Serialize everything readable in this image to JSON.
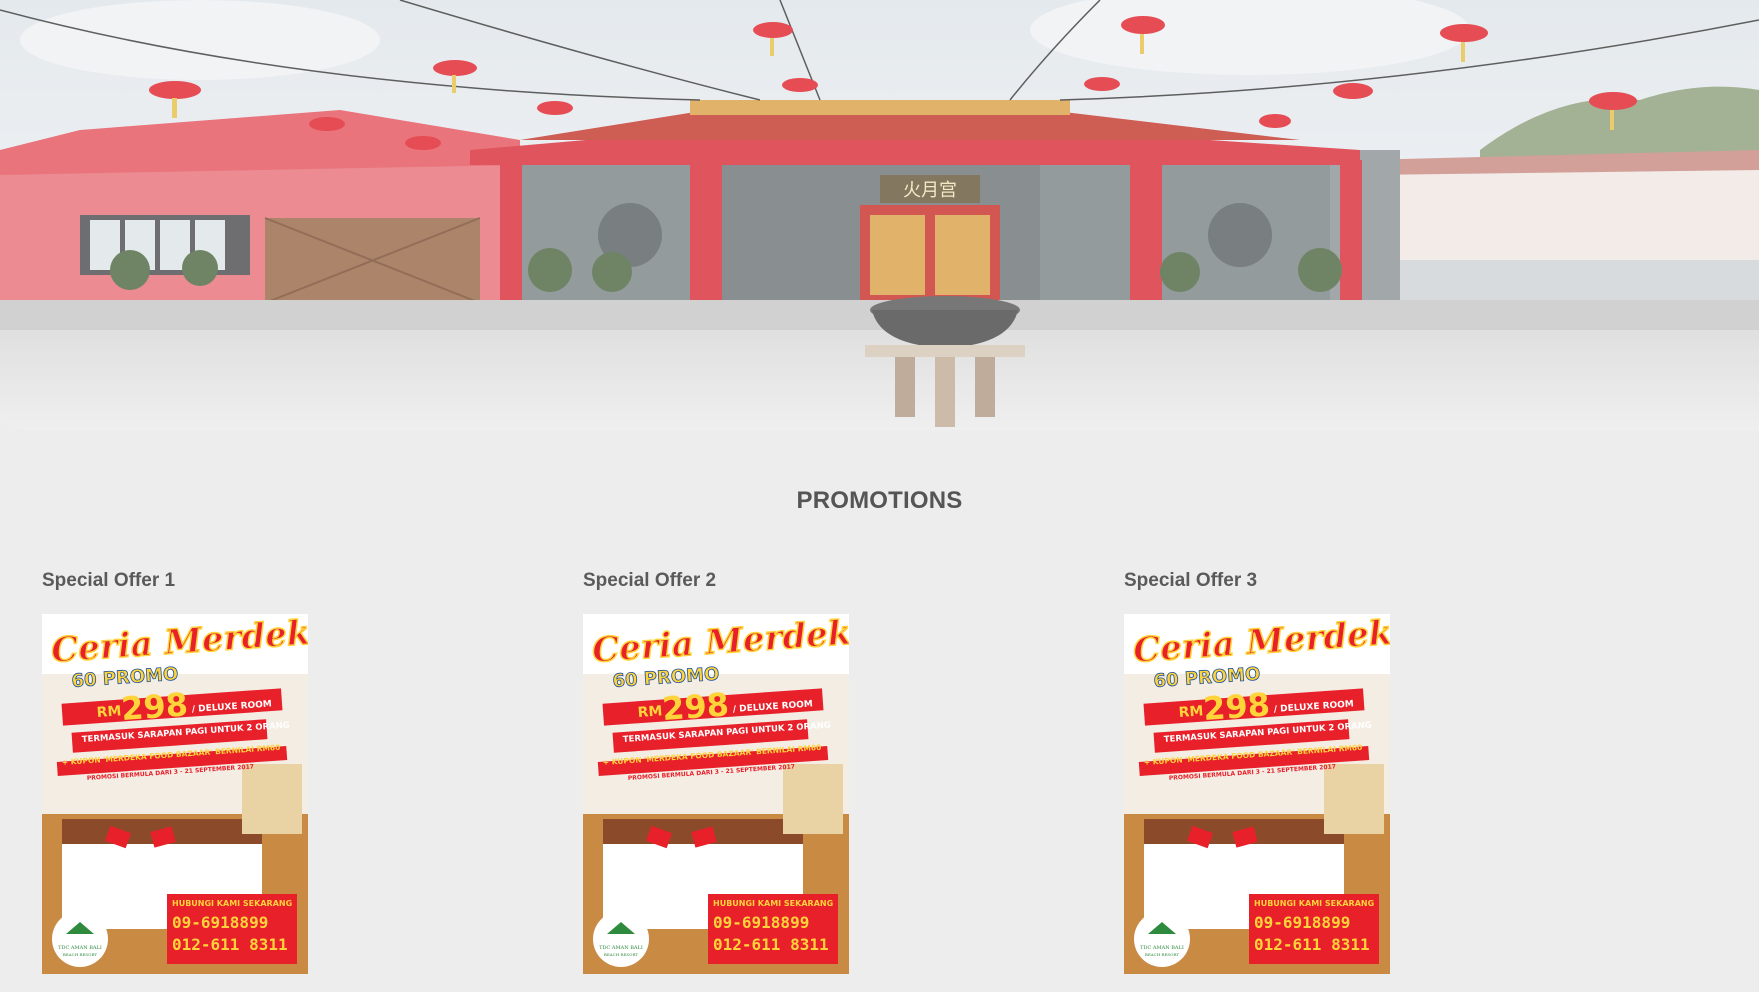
{
  "hero": {
    "image_subject": "Chinese temple with red lanterns",
    "temple_sign": "火月宫"
  },
  "promotions": {
    "title": "PROMOTIONS",
    "offers": [
      {
        "title": "Special Offer 1",
        "poster": {
          "headline": "Ceria Merdeka",
          "subhead": "60 PROMO",
          "currency": "RM",
          "price": "298",
          "room": "/ DELUXE ROOM",
          "line1": "TERMASUK SARAPAN PAGI UNTUK 2 ORANG",
          "line2": "+ KUPON 'MERDEKA FOOD BAZAAR' BERNILAI RM60",
          "line3": "PROMOSI BERMULA DARI 3 - 21 SEPTEMBER 2017",
          "contact_label": "HUBUNGI KAMI SEKARANG",
          "phone1": "09-6918899",
          "phone2": "012-611 8311",
          "logo_text": "TDC AMAN BALI",
          "logo_sub": "BEACH RESORT"
        }
      },
      {
        "title": "Special Offer 2",
        "poster": {
          "headline": "Ceria Merdeka",
          "subhead": "60 PROMO",
          "currency": "RM",
          "price": "298",
          "room": "/ DELUXE ROOM",
          "line1": "TERMASUK SARAPAN PAGI UNTUK 2 ORANG",
          "line2": "+ KUPON 'MERDEKA FOOD BAZAAR' BERNILAI RM60",
          "line3": "PROMOSI BERMULA DARI 3 - 21 SEPTEMBER 2017",
          "contact_label": "HUBUNGI KAMI SEKARANG",
          "phone1": "09-6918899",
          "phone2": "012-611 8311",
          "logo_text": "TDC AMAN BALI",
          "logo_sub": "BEACH RESORT"
        }
      },
      {
        "title": "Special Offer 3",
        "poster": {
          "headline": "Ceria Merdeka",
          "subhead": "60 PROMO",
          "currency": "RM",
          "price": "298",
          "room": "/ DELUXE ROOM",
          "line1": "TERMASUK SARAPAN PAGI UNTUK 2 ORANG",
          "line2": "+ KUPON 'MERDEKA FOOD BAZAAR' BERNILAI RM60",
          "line3": "PROMOSI BERMULA DARI 3 - 21 SEPTEMBER 2017",
          "contact_label": "HUBUNGI KAMI SEKARANG",
          "phone1": "09-6918899",
          "phone2": "012-611 8311",
          "logo_text": "TDC AMAN BALI",
          "logo_sub": "BEACH RESORT"
        }
      }
    ]
  },
  "colors": {
    "page_bg": "#ededed",
    "title_text": "#555555",
    "temple_red": "#d9303a",
    "poster_yellow": "#ffd43b",
    "poster_red": "#e8202a"
  }
}
